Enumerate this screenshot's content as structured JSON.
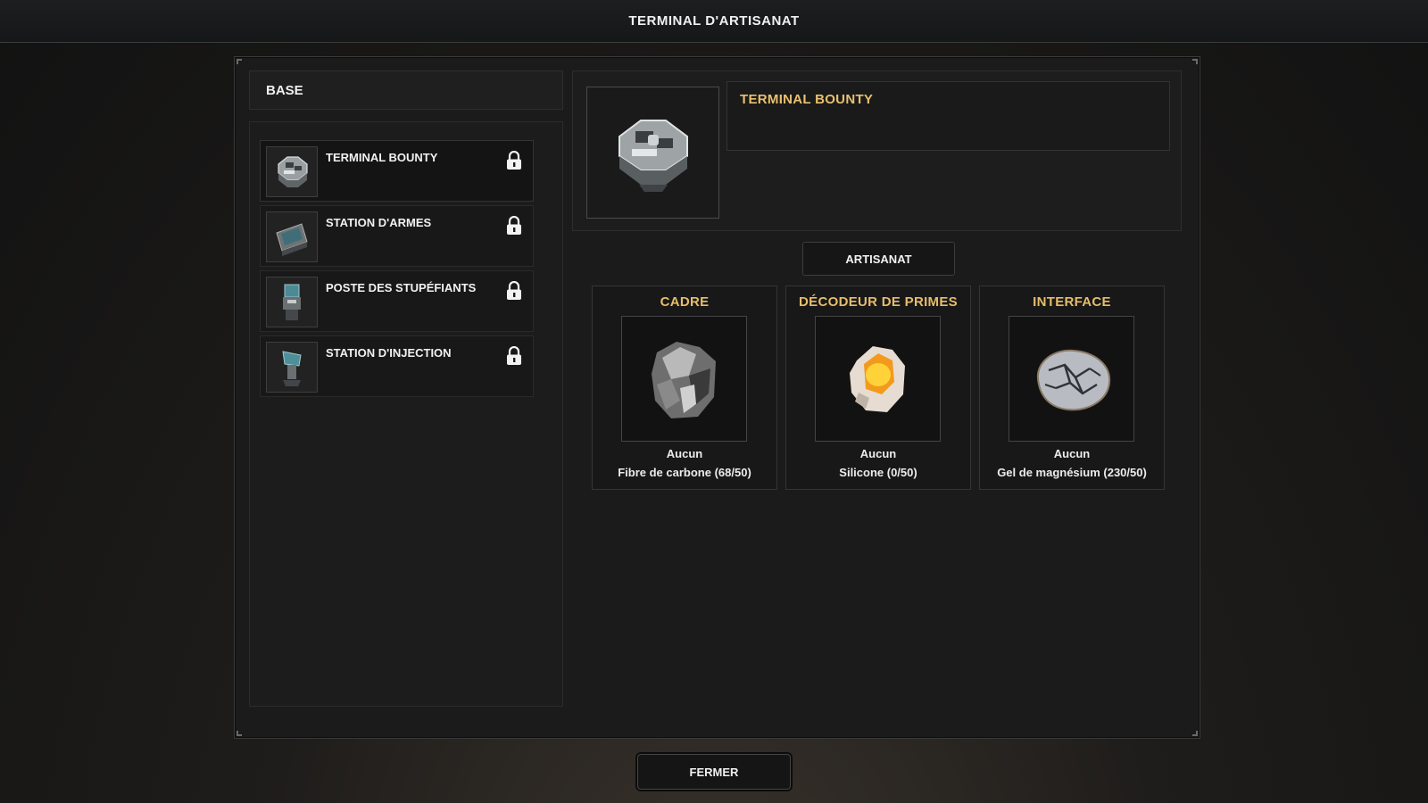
{
  "header": {
    "title": "TERMINAL D'ARTISANAT"
  },
  "category": {
    "label": "BASE"
  },
  "items": [
    {
      "label": "TERMINAL BOUNTY",
      "icon": "bounty-terminal-icon",
      "locked": true
    },
    {
      "label": "STATION D'ARMES",
      "icon": "weapon-station-icon",
      "locked": true
    },
    {
      "label": "POSTE DES STUPÉFIANTS",
      "icon": "drug-station-icon",
      "locked": true
    },
    {
      "label": "STATION D'INJECTION",
      "icon": "injection-station-icon",
      "locked": true
    }
  ],
  "detail": {
    "title": "TERMINAL BOUNTY",
    "icon": "bounty-terminal-icon"
  },
  "craft_button": {
    "label": "ARTISANAT"
  },
  "ingredients": [
    {
      "slot": "CADRE",
      "selected": "Aucun",
      "requirement": "Fibre de carbone (68/50)",
      "icon": "carbon-fiber-icon"
    },
    {
      "slot": "DÉCODEUR DE PRIMES",
      "selected": "Aucun",
      "requirement": "Silicone (0/50)",
      "icon": "silicone-icon"
    },
    {
      "slot": "INTERFACE",
      "selected": "Aucun",
      "requirement": "Gel de magnésium (230/50)",
      "icon": "magnesium-gel-icon"
    }
  ],
  "close_button": {
    "label": "FERMER"
  },
  "colors": {
    "accent": "#e6bd6a",
    "panel": "#1b1b1b",
    "text": "#f0f0f0"
  }
}
